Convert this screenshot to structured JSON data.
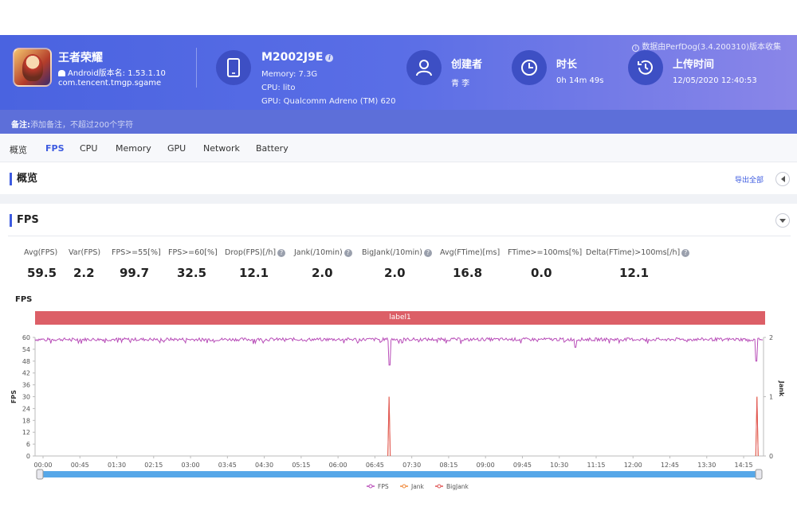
{
  "header": {
    "source_note": "数据由PerfDog(3.4.200310)版本收集",
    "app": {
      "title": "王者荣耀",
      "version": "Android版本名: 1.53.1.10",
      "package": "com.tencent.tmgp.sgame"
    },
    "device": {
      "name": "M2002J9E",
      "memory": "Memory: 7.3G",
      "cpu": "CPU: lito",
      "gpu": "GPU: Qualcomm Adreno (TM) 620"
    },
    "creator": {
      "label": "创建者",
      "value": "青 李"
    },
    "duration": {
      "label": "时长",
      "value": "0h 14m 49s"
    },
    "upload": {
      "label": "上传时间",
      "value": "12/05/2020 12:40:53"
    }
  },
  "remark": {
    "label": "备注:",
    "placeholder": "添加备注，不超过200个字符"
  },
  "tabs": [
    "概览",
    "FPS",
    "CPU",
    "Memory",
    "GPU",
    "Network",
    "Battery"
  ],
  "active_tab": "FPS",
  "overview": {
    "title": "概览",
    "export_label": "导出全部"
  },
  "fps_section": {
    "title": "FPS"
  },
  "stats": [
    {
      "label": "Avg(FPS)",
      "value": "59.5",
      "help": false
    },
    {
      "label": "Var(FPS)",
      "value": "2.2",
      "help": false
    },
    {
      "label": "FPS>=55[%]",
      "value": "99.7",
      "help": false
    },
    {
      "label": "FPS>=60[%]",
      "value": "32.5",
      "help": false
    },
    {
      "label": "Drop(FPS)[/h]",
      "value": "12.1",
      "help": true
    },
    {
      "label": "Jank(/10min)",
      "value": "2.0",
      "help": true
    },
    {
      "label": "BigJank(/10min)",
      "value": "2.0",
      "help": true
    },
    {
      "label": "Avg(FTime)[ms]",
      "value": "16.8",
      "help": false
    },
    {
      "label": "FTime>=100ms[%]",
      "value": "0.0",
      "help": false
    },
    {
      "label": "Delta(FTime)>100ms[/h]",
      "value": "12.1",
      "help": true
    }
  ],
  "chart_data": {
    "type": "line",
    "title": "FPS",
    "band_label": "label1",
    "ylabel": "FPS",
    "y2label": "Jank",
    "ylim": [
      0,
      60
    ],
    "y2lim": [
      0,
      2
    ],
    "yticks": [
      "0",
      "6",
      "12",
      "18",
      "24",
      "30",
      "36",
      "42",
      "48",
      "54",
      "60"
    ],
    "y2ticks": [
      "0",
      "1",
      "2"
    ],
    "xticks": [
      "00:00",
      "00:45",
      "01:30",
      "02:15",
      "03:00",
      "03:45",
      "04:30",
      "05:15",
      "06:00",
      "06:45",
      "07:30",
      "08:15",
      "09:00",
      "09:45",
      "10:30",
      "11:15",
      "12:00",
      "12:45",
      "13:30",
      "14:15"
    ],
    "x_range_seconds": [
      0,
      889
    ],
    "series": [
      {
        "name": "FPS",
        "color": "#b84db8",
        "axis": "left",
        "baseline": 59,
        "events": [
          {
            "t": 432,
            "value": 46
          },
          {
            "t": 660,
            "value": 55
          },
          {
            "t": 880,
            "value": 48
          }
        ]
      },
      {
        "name": "Jank",
        "color": "#f08a3c",
        "axis": "right",
        "events": [
          {
            "t": 432,
            "value": 1
          },
          {
            "t": 881,
            "value": 1
          }
        ]
      },
      {
        "name": "BigJank",
        "color": "#e05555",
        "axis": "right",
        "events": [
          {
            "t": 432,
            "value": 1
          },
          {
            "t": 881,
            "value": 1
          }
        ]
      }
    ],
    "legend": "bottom",
    "grid": true
  }
}
